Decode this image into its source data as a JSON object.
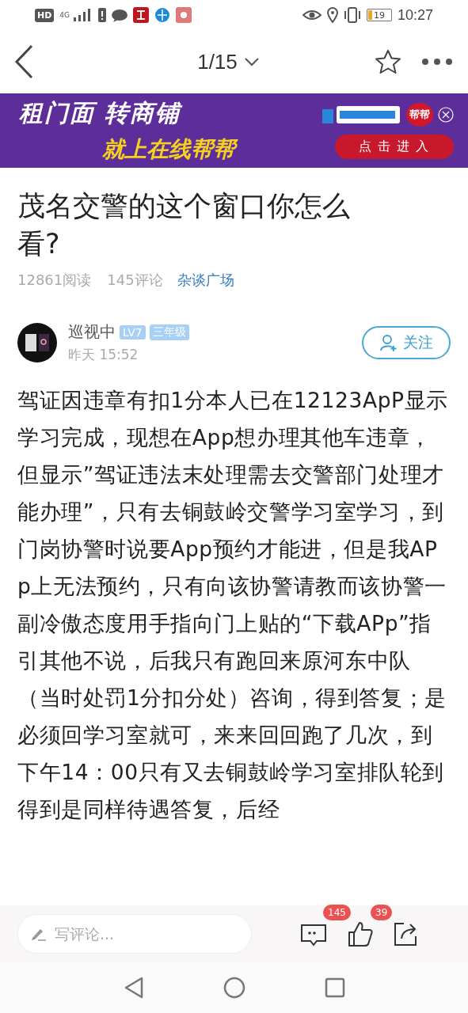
{
  "status_bar": {
    "hd": "HD",
    "network": "4G",
    "time": "10:27",
    "battery": "19"
  },
  "nav": {
    "page": "1/15"
  },
  "banner": {
    "headline": "租门面 转商铺",
    "subline": "就上在线帮帮",
    "badge": "帮帮",
    "cta": "点击进入"
  },
  "post": {
    "title": "茂名交警的这个窗口你怎么看?",
    "reads": "12861阅读",
    "comments": "145评论",
    "forum": "杂谈广场",
    "author": {
      "name": "巡视中",
      "level": "LV7",
      "grade": "三年级",
      "time": "昨天 15:52"
    },
    "follow": {
      "label": "关注",
      "selected": false
    },
    "body": "驾证因违章有扣1分本人已在12123ApP显示学习完成，现想在App想办理其他车违章，但显示”驾证违法末处理需去交警部门处理才能办理”，只有去铜鼓岭交警学习室学习，到门岗协警时说要App预约才能进，但是我APp上无法预约，只有向该协警请教而该协警一副冷傲态度用手指向门上贴的“下载APp”指引其他不说，后我只有跑回来原河东中队（当时处罚1分扣分处）咨询，得到答复；是必须回学习室就可，来来回回跑了几次，到下午14：00只有又去铜鼓岭学习室排队轮到得到是同样待遇答复，后经"
  },
  "bottom_bar": {
    "placeholder": "写评论...",
    "comment_count": "145",
    "like_count": "39"
  }
}
